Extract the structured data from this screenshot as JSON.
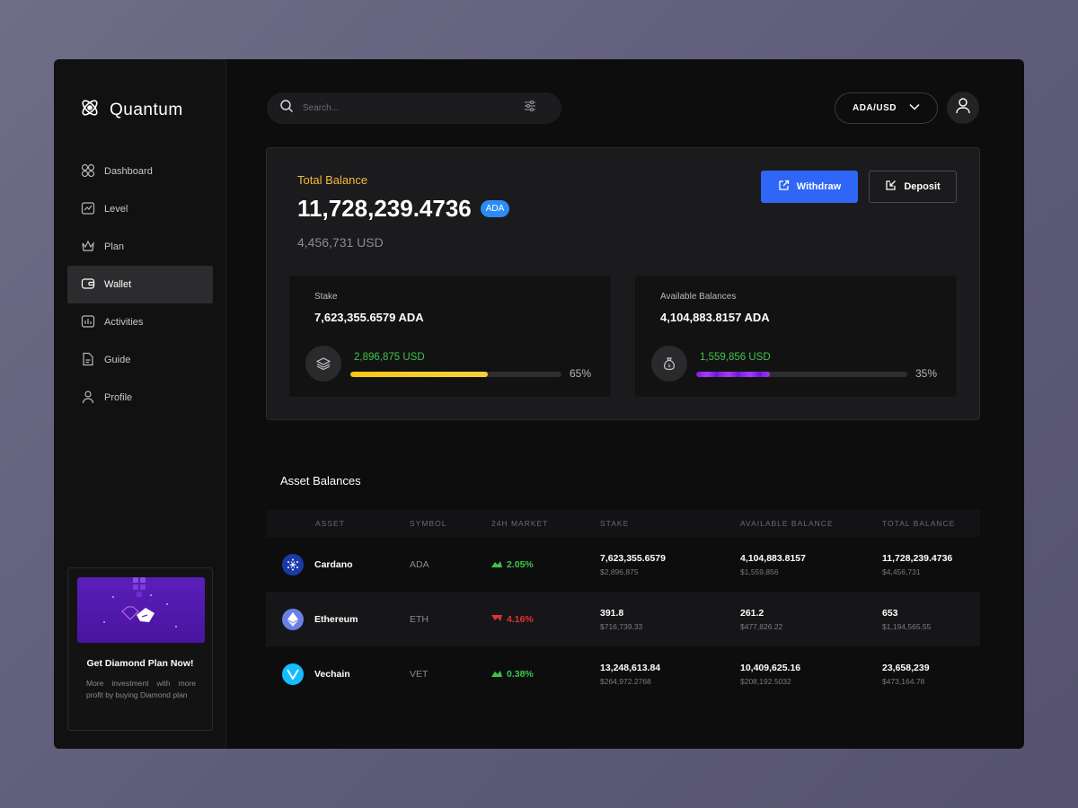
{
  "app": {
    "name": "Quantum"
  },
  "nav": {
    "items": [
      {
        "label": "Dashboard",
        "icon": "grid-icon"
      },
      {
        "label": "Level",
        "icon": "chart-icon"
      },
      {
        "label": "Plan",
        "icon": "crown-icon"
      },
      {
        "label": "Wallet",
        "icon": "wallet-icon",
        "active": true
      },
      {
        "label": "Activities",
        "icon": "bar-chart-icon"
      },
      {
        "label": "Guide",
        "icon": "document-icon"
      },
      {
        "label": "Profile",
        "icon": "user-icon"
      }
    ]
  },
  "promo": {
    "title": "Get Diamond Plan Now!",
    "description": "More investment with more profit by buying Diamond plan"
  },
  "header": {
    "search_placeholder": "Search...",
    "pair": "ADA/USD"
  },
  "balance": {
    "label": "Total Balance",
    "amount": "11,728,239.4736",
    "currency_badge": "ADA",
    "usd": "4,456,731 USD",
    "withdraw_label": "Withdraw",
    "deposit_label": "Deposit"
  },
  "stake": {
    "label": "Stake",
    "value": "7,623,355.6579 ADA",
    "usd": "2,896,875 USD",
    "percent_text": "65%",
    "percent": 65
  },
  "available": {
    "label": "Available Balances",
    "value": "4,104,883.8157 ADA",
    "usd": "1,559,856 USD",
    "percent_text": "35%",
    "percent": 35
  },
  "assets": {
    "title": "Asset Balances",
    "columns": [
      "ASSET",
      "SYMBOL",
      "24H MARKET",
      "STAKE",
      "AVAILABLE BALANCE",
      "TOTAL BALANCE"
    ],
    "rows": [
      {
        "name": "Cardano",
        "symbol": "ADA",
        "market": "2.05%",
        "trend": "up",
        "stake": "7,623,355.6579",
        "stake_usd": "$2,896,875",
        "available": "4,104,883.8157",
        "available_usd": "$1,559,856",
        "total": "11,728,239.4736",
        "total_usd": "$4,456,731"
      },
      {
        "name": "Ethereum",
        "symbol": "ETH",
        "market": "4.16%",
        "trend": "down",
        "stake": "391.8",
        "stake_usd": "$716,739.33",
        "available": "261.2",
        "available_usd": "$477,826.22",
        "total": "653",
        "total_usd": "$1,194,565.55"
      },
      {
        "name": "Vechain",
        "symbol": "VET",
        "market": "0.38%",
        "trend": "up",
        "stake": "13,248,613.84",
        "stake_usd": "$264,972.2768",
        "available": "10,409,625.16",
        "available_usd": "$208,192.5032",
        "total": "23,658,239",
        "total_usd": "$473,164.78"
      }
    ]
  },
  "colors": {
    "accent_blue": "#2f66f5",
    "gold": "#f5b938",
    "positive": "#3fc54a",
    "negative": "#e0303a"
  }
}
